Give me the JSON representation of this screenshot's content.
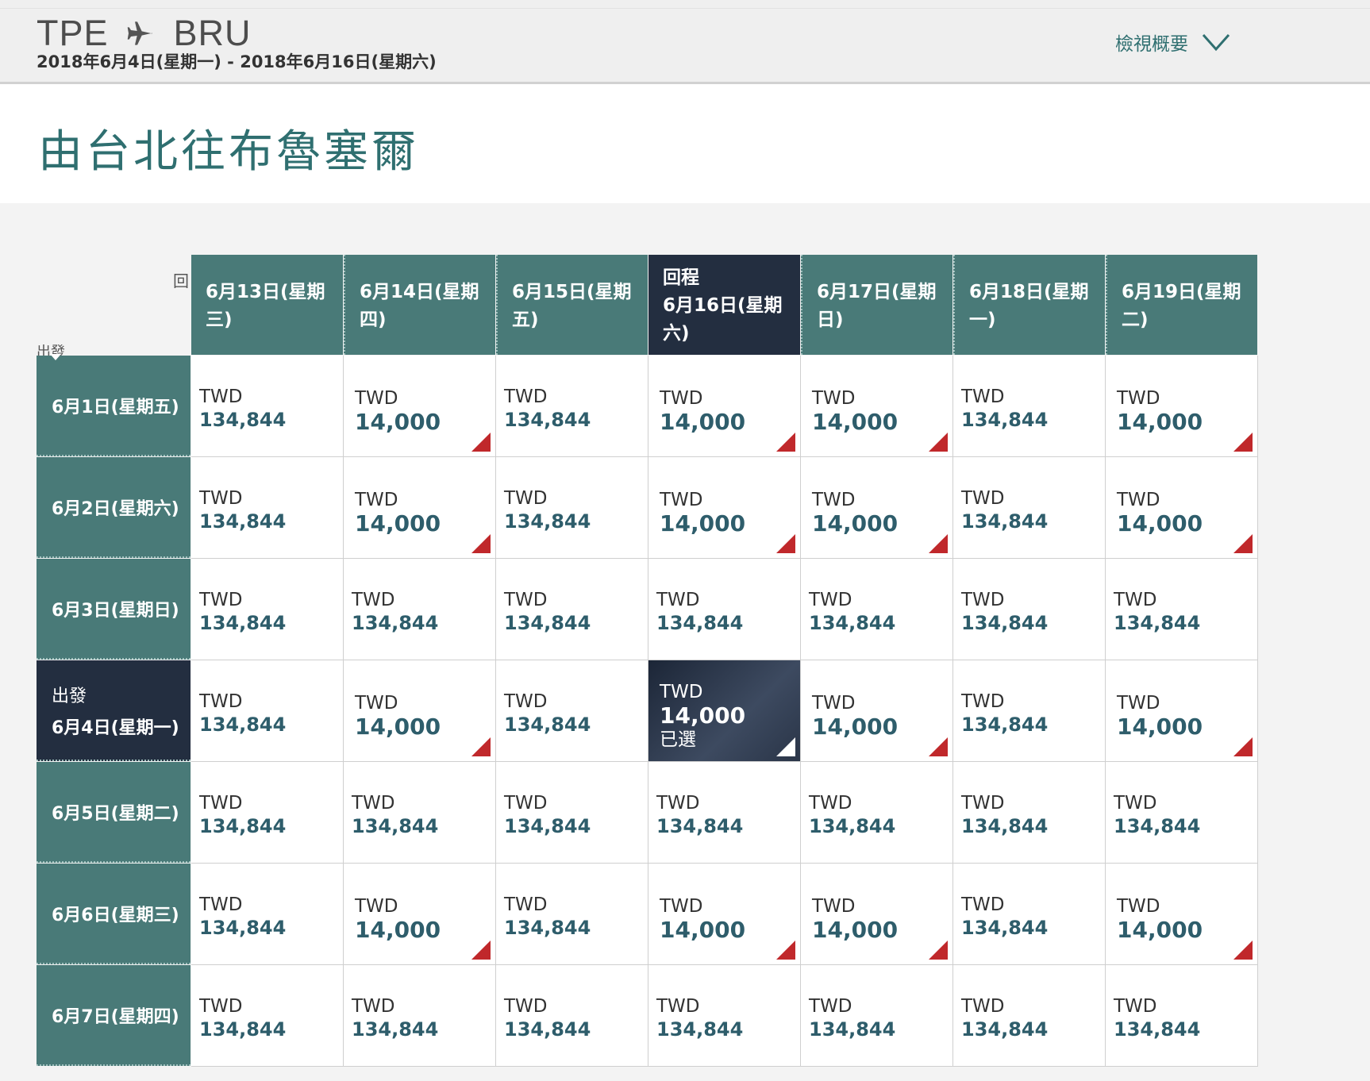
{
  "header": {
    "origin": "TPE",
    "destination": "BRU",
    "date_range": "2018年6月4日(星期一) - 2018年6月16日(星期六)",
    "summary_link": "檢視概要"
  },
  "page_title": "由台北往布魯塞爾",
  "grid": {
    "return_axis_label": "回",
    "departure_axis_label": "出發",
    "columns": [
      {
        "label": "",
        "date": "6月13日(星期三)"
      },
      {
        "label": "",
        "date": "6月14日(星期四)"
      },
      {
        "label": "",
        "date": "6月15日(星期五)"
      },
      {
        "label": "回程",
        "date": "6月16日(星期六)"
      },
      {
        "label": "",
        "date": "6月17日(星期日)"
      },
      {
        "label": "",
        "date": "6月18日(星期一)"
      },
      {
        "label": "",
        "date": "6月19日(星期二)"
      }
    ],
    "rows": [
      {
        "label": "",
        "date": "6月1日(星期五)",
        "cells": [
          {
            "currency": "TWD",
            "amount": "134,844"
          },
          {
            "currency": "TWD",
            "amount": "14,000"
          },
          {
            "currency": "TWD",
            "amount": "134,844"
          },
          {
            "currency": "TWD",
            "amount": "14,000"
          },
          {
            "currency": "TWD",
            "amount": "14,000"
          },
          {
            "currency": "TWD",
            "amount": "134,844"
          },
          {
            "currency": "TWD",
            "amount": "14,000"
          }
        ]
      },
      {
        "label": "",
        "date": "6月2日(星期六)",
        "cells": [
          {
            "currency": "TWD",
            "amount": "134,844"
          },
          {
            "currency": "TWD",
            "amount": "14,000"
          },
          {
            "currency": "TWD",
            "amount": "134,844"
          },
          {
            "currency": "TWD",
            "amount": "14,000"
          },
          {
            "currency": "TWD",
            "amount": "14,000"
          },
          {
            "currency": "TWD",
            "amount": "134,844"
          },
          {
            "currency": "TWD",
            "amount": "14,000"
          }
        ]
      },
      {
        "label": "",
        "date": "6月3日(星期日)",
        "cells": [
          {
            "currency": "TWD",
            "amount": "134,844"
          },
          {
            "currency": "TWD",
            "amount": "134,844"
          },
          {
            "currency": "TWD",
            "amount": "134,844"
          },
          {
            "currency": "TWD",
            "amount": "134,844"
          },
          {
            "currency": "TWD",
            "amount": "134,844"
          },
          {
            "currency": "TWD",
            "amount": "134,844"
          },
          {
            "currency": "TWD",
            "amount": "134,844"
          }
        ]
      },
      {
        "label": "出發",
        "date": "6月4日(星期一)",
        "cells": [
          {
            "currency": "TWD",
            "amount": "134,844"
          },
          {
            "currency": "TWD",
            "amount": "14,000"
          },
          {
            "currency": "TWD",
            "amount": "134,844"
          },
          {
            "currency": "TWD",
            "amount": "14,000",
            "selected_label": "已選"
          },
          {
            "currency": "TWD",
            "amount": "14,000"
          },
          {
            "currency": "TWD",
            "amount": "134,844"
          },
          {
            "currency": "TWD",
            "amount": "14,000"
          }
        ]
      },
      {
        "label": "",
        "date": "6月5日(星期二)",
        "cells": [
          {
            "currency": "TWD",
            "amount": "134,844"
          },
          {
            "currency": "TWD",
            "amount": "134,844"
          },
          {
            "currency": "TWD",
            "amount": "134,844"
          },
          {
            "currency": "TWD",
            "amount": "134,844"
          },
          {
            "currency": "TWD",
            "amount": "134,844"
          },
          {
            "currency": "TWD",
            "amount": "134,844"
          },
          {
            "currency": "TWD",
            "amount": "134,844"
          }
        ]
      },
      {
        "label": "",
        "date": "6月6日(星期三)",
        "cells": [
          {
            "currency": "TWD",
            "amount": "134,844"
          },
          {
            "currency": "TWD",
            "amount": "14,000"
          },
          {
            "currency": "TWD",
            "amount": "134,844"
          },
          {
            "currency": "TWD",
            "amount": "14,000"
          },
          {
            "currency": "TWD",
            "amount": "14,000"
          },
          {
            "currency": "TWD",
            "amount": "134,844"
          },
          {
            "currency": "TWD",
            "amount": "14,000"
          }
        ]
      },
      {
        "label": "",
        "date": "6月7日(星期四)",
        "cells": [
          {
            "currency": "TWD",
            "amount": "134,844"
          },
          {
            "currency": "TWD",
            "amount": "134,844"
          },
          {
            "currency": "TWD",
            "amount": "134,844"
          },
          {
            "currency": "TWD",
            "amount": "134,844"
          },
          {
            "currency": "TWD",
            "amount": "134,844"
          },
          {
            "currency": "TWD",
            "amount": "134,844"
          },
          {
            "currency": "TWD",
            "amount": "134,844"
          }
        ]
      }
    ]
  },
  "colors": {
    "teal": "#497a78",
    "navy_selected": "#232e40",
    "accent_text": "#2f6f70",
    "price_text": "#2e5d6b",
    "low_fare_flag": "#c0282b"
  },
  "icons": {
    "plane": "plane-icon",
    "chevron": "chevron-down-icon",
    "low_fare": "low-fare-flag-icon",
    "selected": "selected-corner-icon"
  }
}
